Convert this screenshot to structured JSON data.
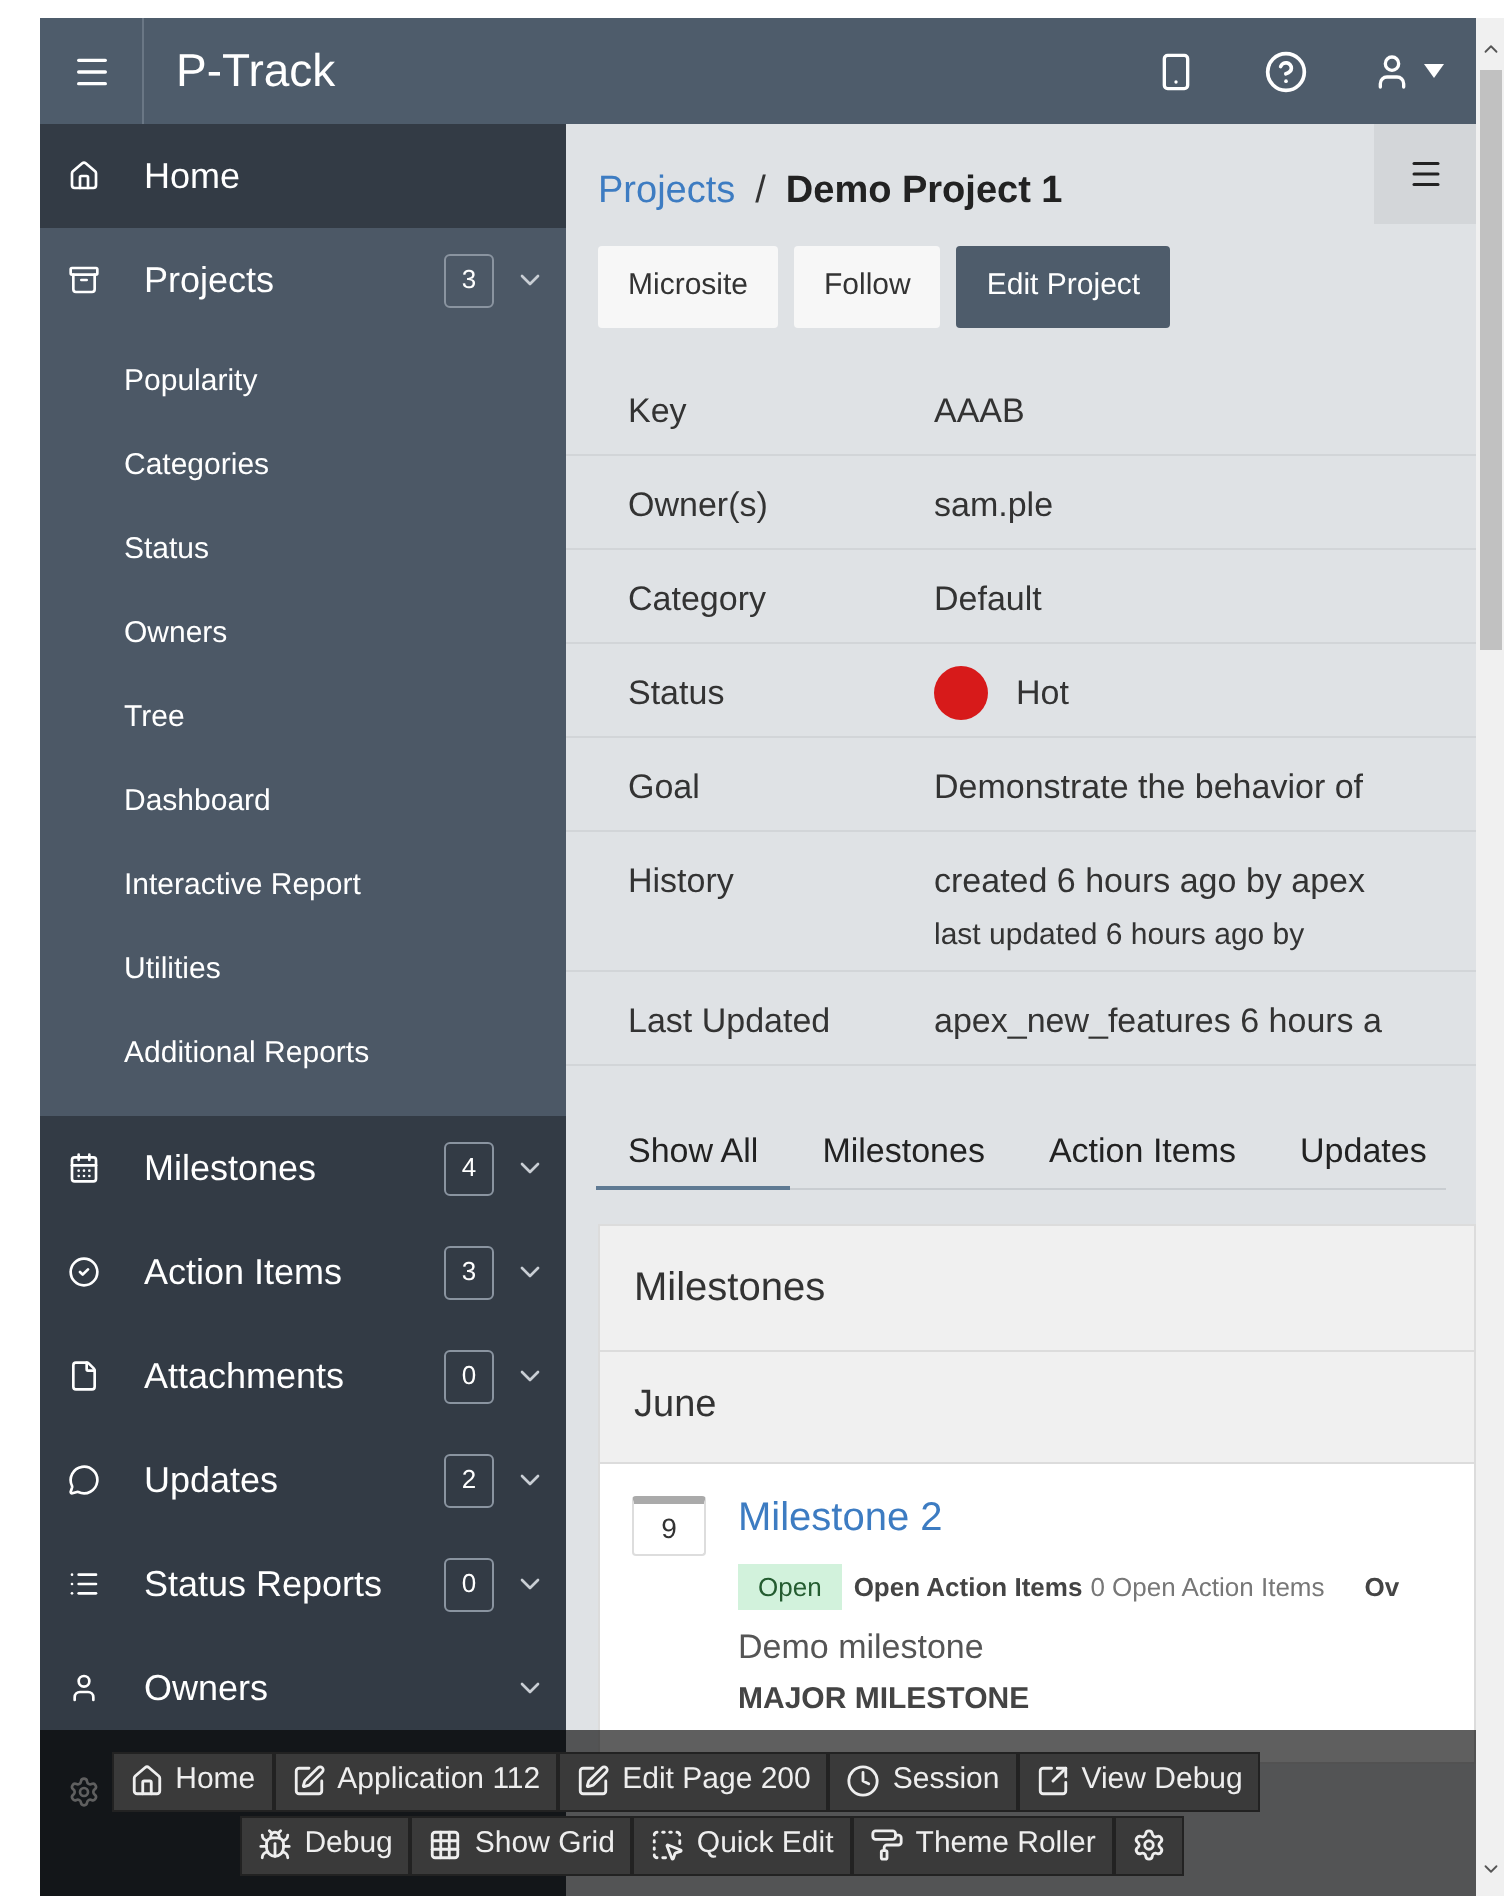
{
  "header": {
    "title": "P-Track"
  },
  "sidebar": {
    "items": [
      {
        "label": "Home",
        "selected": false,
        "collapsible": false
      },
      {
        "label": "Projects",
        "badge": "3",
        "selected": true,
        "collapsible": true,
        "children": [
          {
            "label": "Popularity"
          },
          {
            "label": "Categories"
          },
          {
            "label": "Status"
          },
          {
            "label": "Owners"
          },
          {
            "label": "Tree"
          },
          {
            "label": "Dashboard"
          },
          {
            "label": "Interactive Report"
          },
          {
            "label": "Utilities"
          },
          {
            "label": "Additional Reports"
          }
        ]
      },
      {
        "label": "Milestones",
        "badge": "4",
        "selected": false,
        "collapsible": true
      },
      {
        "label": "Action Items",
        "badge": "3",
        "selected": false,
        "collapsible": true
      },
      {
        "label": "Attachments",
        "badge": "0",
        "selected": false,
        "collapsible": true
      },
      {
        "label": "Updates",
        "badge": "2",
        "selected": false,
        "collapsible": true
      },
      {
        "label": "Status Reports",
        "badge": "0",
        "selected": false,
        "collapsible": true
      },
      {
        "label": "Owners",
        "selected": false,
        "collapsible": true
      },
      {
        "selected": false
      }
    ]
  },
  "breadcrumb": {
    "parent": "Projects",
    "separator": "/",
    "current": "Demo Project 1"
  },
  "buttons": [
    {
      "label": "Microsite",
      "kind": "plain"
    },
    {
      "label": "Follow",
      "kind": "plain"
    },
    {
      "label": "Edit Project",
      "kind": "primary"
    }
  ],
  "details": [
    {
      "label": "Key",
      "value": "AAAB"
    },
    {
      "label": "Owner(s)",
      "value": "sam.ple"
    },
    {
      "label": "Category",
      "value": "Default"
    },
    {
      "label": "Status",
      "value": "Hot",
      "color": "#d71a1a"
    },
    {
      "label": "Goal",
      "value": "Demonstrate the behavior of"
    },
    {
      "label": "History",
      "value": "created 6 hours ago by apex",
      "value_2": "last updated 6 hours ago by"
    },
    {
      "label": "Last Updated",
      "value": "apex_new_features 6 hours a"
    }
  ],
  "tabs": [
    {
      "label": "Show All",
      "selected": true
    },
    {
      "label": "Milestones",
      "selected": false
    },
    {
      "label": "Action Items",
      "selected": false
    },
    {
      "label": "Updates",
      "selected": false
    }
  ],
  "region": {
    "title": "Milestones",
    "group": "June",
    "milestone": {
      "day": "9",
      "title": "Milestone 2",
      "status": "Open",
      "meta_label": "Open Action Items",
      "meta_value": "0 Open Action Items",
      "meta_cut": "Ov",
      "description": "Demo milestone",
      "type": "MAJOR MILESTONE"
    }
  },
  "dev_toolbar": {
    "row_1": [
      "Home",
      "Application 112",
      "Edit Page 200",
      "Session",
      "View Debug"
    ],
    "row_2": [
      "Debug",
      "Show Grid",
      "Quick Edit",
      "Theme Roller"
    ]
  }
}
